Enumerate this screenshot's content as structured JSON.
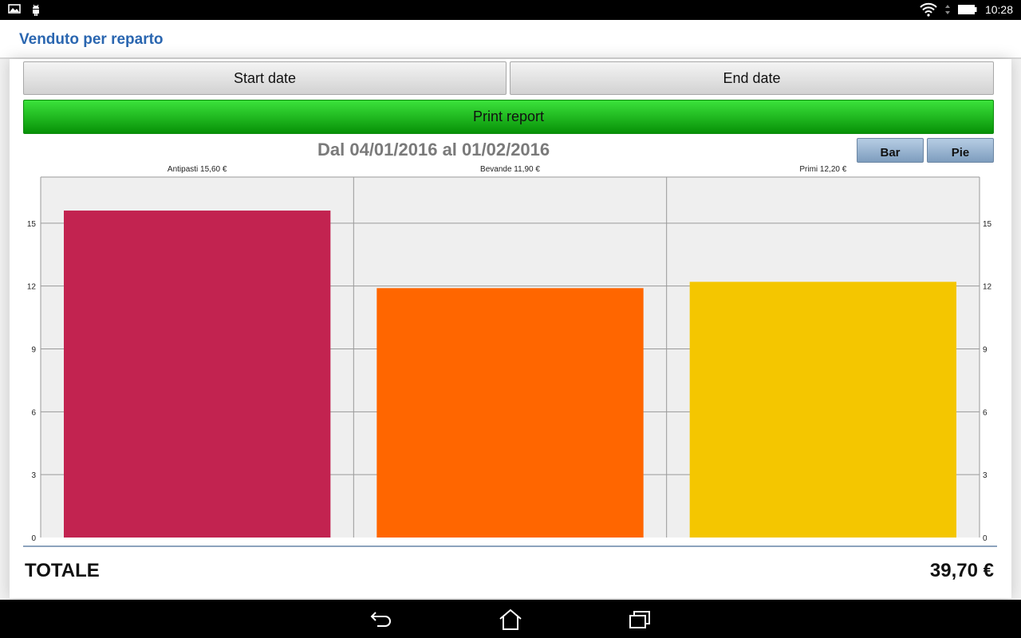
{
  "status_bar": {
    "time": "10:28"
  },
  "app": {
    "title": "Venduto per reparto"
  },
  "buttons": {
    "start_date": "Start date",
    "end_date": "End date",
    "print_report": "Print report",
    "bar": "Bar",
    "pie": "Pie"
  },
  "period_label": "Dal 04/01/2016 al 01/02/2016",
  "totals": {
    "label": "TOTALE",
    "value": "39,70 €"
  },
  "chart_data": {
    "type": "bar",
    "categories": [
      "Antipasti",
      "Bevande",
      "Primi"
    ],
    "values": [
      15.6,
      11.9,
      12.2
    ],
    "category_labels": [
      "Antipasti 15,60 €",
      "Bevande 11,90 €",
      "Primi 12,20 €"
    ],
    "colors": [
      "#c22350",
      "#ff6600",
      "#f4c600"
    ],
    "ylim": [
      0,
      17.2
    ],
    "yticks": [
      0,
      3,
      6,
      9,
      12,
      15
    ],
    "grid": true,
    "plot_background": "#efefef",
    "grid_color": "#9a9a9a"
  }
}
